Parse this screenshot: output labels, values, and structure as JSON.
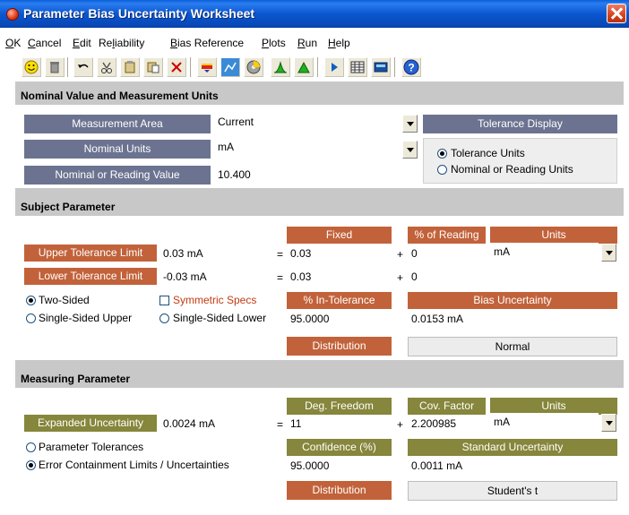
{
  "window": {
    "title": "Parameter Bias Uncertainty Worksheet"
  },
  "menu": [
    {
      "label": "OK",
      "u": "O",
      "rest": "K"
    },
    {
      "label": "Cancel",
      "u": "C",
      "rest": "ancel"
    },
    {
      "label": "Edit",
      "u": "E",
      "rest": "dit"
    },
    {
      "label": "Reliability",
      "pre": "Re",
      "u": "l",
      "rest": "iability"
    },
    {
      "label": "Bias Reference",
      "u": "B",
      "rest": "ias Reference"
    },
    {
      "label": "Plots",
      "u": "P",
      "rest": "lots"
    },
    {
      "label": "Run",
      "u": "R",
      "rest": "un"
    },
    {
      "label": "Help",
      "u": "H",
      "rest": "elp"
    }
  ],
  "toolbar": {
    "icons": [
      "smiley-icon",
      "trash-icon",
      "undo-icon",
      "copy-icon",
      "paste-icon",
      "paste-special-icon",
      "delete-icon",
      "pen-icon",
      "chart-icon",
      "disk-icon",
      "green-peak-icon",
      "green-triangle-icon",
      "play-icon",
      "table-icon",
      "calc-icon",
      "help-icon"
    ]
  },
  "nominal": {
    "title": "Nominal Value and Measurement Units",
    "area_label": "Measurement Area",
    "area_value": "Current",
    "units_label": "Nominal Units",
    "units_value": "mA",
    "value_label": "Nominal or Reading Value",
    "value_value": "10.400",
    "tolerance_display_label": "Tolerance Display",
    "opt_tolerance_units": "Tolerance Units",
    "opt_nominal_units": "Nominal or Reading Units"
  },
  "subject": {
    "title": "Subject Parameter",
    "col_fixed": "Fixed",
    "col_pct": "% of Reading",
    "col_units": "Units",
    "units_value": "mA",
    "upper_label": "Upper Tolerance Limit",
    "upper_value": "0.03 mA",
    "upper_fixed": "0.03",
    "upper_pct": "0",
    "lower_label": "Lower Tolerance Limit",
    "lower_value": "-0.03 mA",
    "lower_fixed": "0.03",
    "lower_pct": "0",
    "opt_two_sided": "Two-Sided",
    "opt_symmetric": "Symmetric Specs",
    "opt_single_upper": "Single-Sided Upper",
    "opt_single_lower": "Single-Sided Lower",
    "in_tol_label": "% In-Tolerance",
    "in_tol_value": "95.0000",
    "bias_label": "Bias Uncertainty",
    "bias_value": "0.0153 mA",
    "dist_label": "Distribution",
    "dist_value": "Normal",
    "eq": "=",
    "plus": "+"
  },
  "measuring": {
    "title": "Measuring Parameter",
    "col_dof": "Deg. Freedom",
    "col_cov": "Cov. Factor",
    "col_units": "Units",
    "units_value": "mA",
    "exp_label": "Expanded Uncertainty",
    "exp_value": "0.0024 mA",
    "dof_value": "11",
    "cov_value": "2.200985",
    "opt_param_tol": "Parameter Tolerances",
    "opt_error_limits": "Error Containment Limits / Uncertainties",
    "conf_label": "Confidence (%)",
    "conf_value": "95.0000",
    "std_label": "Standard Uncertainty",
    "std_value": "0.0011 mA",
    "dist_label": "Distribution",
    "dist_value": "Student's t",
    "eq": "=",
    "plus": "+"
  }
}
